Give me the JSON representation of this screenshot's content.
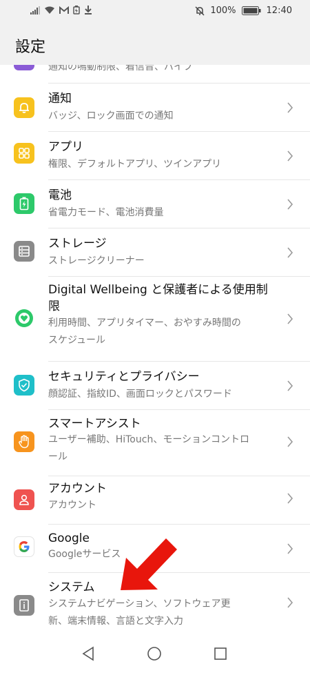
{
  "status": {
    "battery_percent": "100%",
    "time": "12:40",
    "icons": [
      "signal-icon",
      "wifi-icon",
      "mail-icon",
      "battery-saver-icon",
      "download-icon",
      "mute-icon",
      "battery-icon"
    ]
  },
  "header": {
    "title": "設定"
  },
  "partial_item": {
    "subtitle": "通知の鳴動制限、着信音、バイブ",
    "icon": "sound-icon",
    "color": "#8a5bd6"
  },
  "items": [
    {
      "title": "通知",
      "subtitle": "バッジ、ロック画面での通知",
      "icon": "bell-icon",
      "color": "#f7c21e"
    },
    {
      "title": "アプリ",
      "subtitle": "権限、デフォルトアプリ、ツインアプリ",
      "icon": "apps-grid-icon",
      "color": "#f7c21e"
    },
    {
      "title": "電池",
      "subtitle": "省電力モード、電池消費量",
      "icon": "battery-icon",
      "color": "#2dc96a"
    },
    {
      "title": "ストレージ",
      "subtitle": "ストレージクリーナー",
      "icon": "storage-icon",
      "color": "#8a8a8a"
    },
    {
      "title_line1": "Digital Wellbeing と保護者による使用制",
      "title_line2": "限",
      "subtitle_line1": "利用時間、アプリタイマー、おやすみ時間の",
      "subtitle_line2": "スケジュール",
      "icon": "wellbeing-heart-icon",
      "color": "#2dc96a"
    },
    {
      "title": "セキュリティとプライバシー",
      "subtitle": "顔認証、指紋ID、画面ロックとパスワード",
      "icon": "shield-check-icon",
      "color": "#1fbfc9"
    },
    {
      "title": "スマートアシスト",
      "subtitle_line1": "ユーザー補助、HiTouch、モーションコントロ",
      "subtitle_line2": "ール",
      "icon": "hand-icon",
      "color": "#f7941e"
    },
    {
      "title": "アカウント",
      "subtitle": "アカウント",
      "icon": "account-icon",
      "color": "#ef5350"
    },
    {
      "title": "Google",
      "subtitle": "Googleサービス",
      "icon": "google-icon",
      "color": "#ffffff"
    },
    {
      "title": "システム",
      "subtitle_line1": "システムナビゲーション、ソフトウェア更",
      "subtitle_line2": "新、端末情報、言語と文字入力",
      "icon": "system-info-icon",
      "color": "#8a8a8a"
    }
  ],
  "nav": {
    "back": "back-icon",
    "home": "home-icon",
    "recents": "recents-icon"
  },
  "annotation": {
    "color": "#e8160c"
  }
}
